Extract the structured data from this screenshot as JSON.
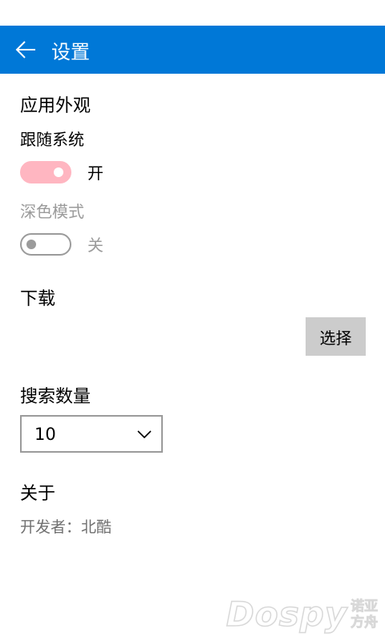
{
  "header": {
    "title": "设置"
  },
  "appearance": {
    "title": "应用外观",
    "follow_system": {
      "label": "跟随系统",
      "state_text": "开",
      "on": true
    },
    "dark_mode": {
      "label": "深色模式",
      "state_text": "关",
      "on": false
    }
  },
  "download": {
    "title": "下载",
    "select_label": "选择"
  },
  "search_count": {
    "title": "搜索数量",
    "value": "10"
  },
  "about": {
    "title": "关于",
    "developer": "开发者：北酷"
  },
  "watermark": {
    "main": "Dospy",
    "side_top": "诺亚",
    "side_bottom": "方舟"
  },
  "colors": {
    "accent": "#0078d7",
    "toggle_on": "#ffb6c1",
    "disabled_text": "#9b9b9b",
    "button_bg": "#cccccc"
  },
  "icons": {
    "back": "arrow-left-icon",
    "dropdown": "chevron-down-icon"
  }
}
